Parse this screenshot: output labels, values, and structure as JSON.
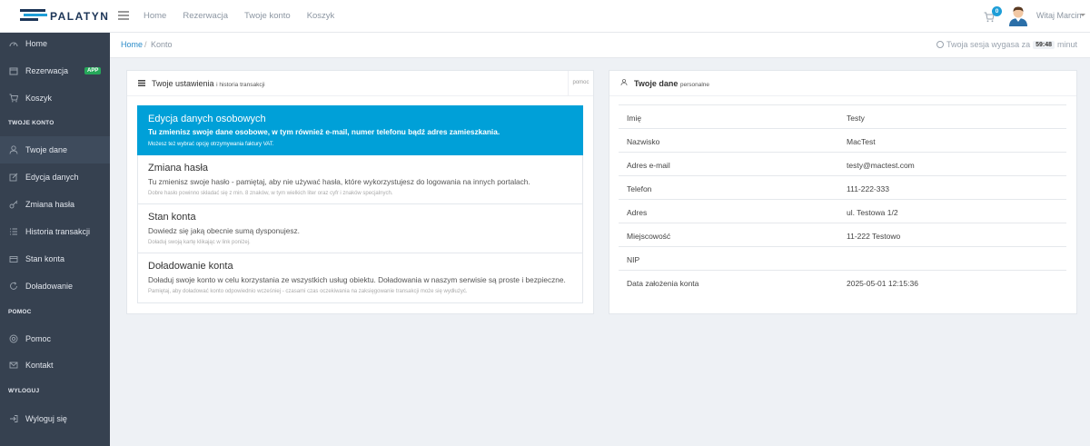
{
  "app": {
    "logo_text": "PALATYN",
    "brand_color": "#1e9ed8"
  },
  "topnav": {
    "items": [
      "Home",
      "Rezerwacja",
      "Twoje konto",
      "Koszyk"
    ]
  },
  "header": {
    "cart_count": "0",
    "user_greeting": "Witaj Marcin"
  },
  "sidebar": {
    "items": [
      {
        "label": "Home",
        "icon": "dashboard-icon"
      },
      {
        "label": "Rezerwacja",
        "icon": "calendar-icon",
        "badge": "APP"
      },
      {
        "label": "Koszyk",
        "icon": "cart-icon"
      }
    ],
    "section_account": "TWOJE KONTO",
    "account_items": [
      {
        "label": "Twoje dane",
        "icon": "user-icon"
      },
      {
        "label": "Edycja danych",
        "icon": "edit-icon"
      },
      {
        "label": "Zmiana hasła",
        "icon": "key-icon"
      },
      {
        "label": "Historia transakcji",
        "icon": "list-icon"
      },
      {
        "label": "Stan konta",
        "icon": "wallet-icon"
      },
      {
        "label": "Doładowanie",
        "icon": "refresh-icon"
      }
    ],
    "section_help": "POMOC",
    "help_items": [
      {
        "label": "Pomoc",
        "icon": "lifebuoy-icon"
      },
      {
        "label": "Kontakt",
        "icon": "envelope-icon"
      }
    ],
    "section_logout": "WYLOGUJ",
    "logout_items": [
      {
        "label": "Wyloguj się",
        "icon": "logout-icon"
      }
    ]
  },
  "breadcrumb": {
    "home": "Home",
    "separator": "/",
    "current": "Konto"
  },
  "session": {
    "prefix": "Twoja sesja wygasa za",
    "time": "59:48",
    "suffix": "minut"
  },
  "settings_panel": {
    "title": "Twoje ustawienia",
    "subtitle": "i historia transakcji",
    "help": "pomoc",
    "options": [
      {
        "title": "Edycja danych osobowych",
        "desc": "Tu zmienisz swoje dane osobowe, w tym również e-mail, numer telefonu bądź adres zamieszkania.",
        "note": "Możesz też wybrać opcję otrzymywania faktury VAT."
      },
      {
        "title": "Zmiana hasła",
        "desc": "Tu zmienisz swoje hasło - pamiętaj, aby nie używać hasła, które wykorzystujesz do logowania na innych portalach.",
        "note": "Dobre hasło powinno składać się z min. 8 znaków, w tym wielkich liter oraz cyfr i znaków specjalnych."
      },
      {
        "title": "Stan konta",
        "desc": "Dowiedz się jaką obecnie sumą dysponujesz.",
        "note": "Doładuj swoją kartę klikając w link poniżej."
      },
      {
        "title": "Doładowanie konta",
        "desc": "Doładuj swoje konto w celu korzystania ze wszystkich usług obiektu. Doładowania w naszym serwisie są proste i bezpieczne.",
        "note": "Pamiętaj, aby doładować konto odpowiednio wcześniej - czasami czas oczekiwania na zaksięgowanie transakcji może się wydłużyć."
      }
    ]
  },
  "personal_panel": {
    "title": "Twoje dane",
    "subtitle": "personalne",
    "rows": [
      {
        "label": "Imię",
        "value": "Testy"
      },
      {
        "label": "Nazwisko",
        "value": "MacTest"
      },
      {
        "label": "Adres e-mail",
        "value": "testy@mactest.com"
      },
      {
        "label": "Telefon",
        "value": "111-222-333"
      },
      {
        "label": "Adres",
        "value": "ul. Testowa 1/2"
      },
      {
        "label": "Miejscowość",
        "value": "11-222 Testowo"
      },
      {
        "label": "NIP",
        "value": ""
      },
      {
        "label": "Data założenia konta",
        "value": "2025-05-01 12:15:36"
      }
    ]
  }
}
